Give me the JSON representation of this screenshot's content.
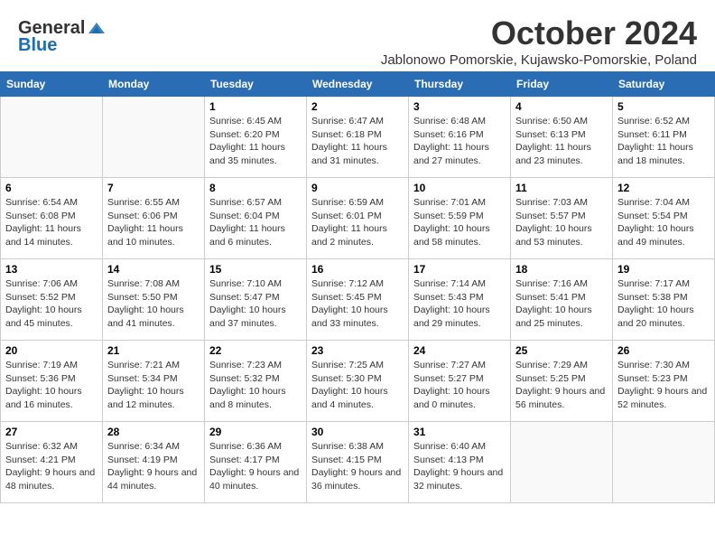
{
  "header": {
    "logo_general": "General",
    "logo_blue": "Blue",
    "title": "October 2024",
    "subtitle": "Jablonowo Pomorskie, Kujawsko-Pomorskie, Poland"
  },
  "weekdays": [
    "Sunday",
    "Monday",
    "Tuesday",
    "Wednesday",
    "Thursday",
    "Friday",
    "Saturday"
  ],
  "weeks": [
    [
      {
        "day": "",
        "info": ""
      },
      {
        "day": "",
        "info": ""
      },
      {
        "day": "1",
        "info": "Sunrise: 6:45 AM\nSunset: 6:20 PM\nDaylight: 11 hours and 35 minutes."
      },
      {
        "day": "2",
        "info": "Sunrise: 6:47 AM\nSunset: 6:18 PM\nDaylight: 11 hours and 31 minutes."
      },
      {
        "day": "3",
        "info": "Sunrise: 6:48 AM\nSunset: 6:16 PM\nDaylight: 11 hours and 27 minutes."
      },
      {
        "day": "4",
        "info": "Sunrise: 6:50 AM\nSunset: 6:13 PM\nDaylight: 11 hours and 23 minutes."
      },
      {
        "day": "5",
        "info": "Sunrise: 6:52 AM\nSunset: 6:11 PM\nDaylight: 11 hours and 18 minutes."
      }
    ],
    [
      {
        "day": "6",
        "info": "Sunrise: 6:54 AM\nSunset: 6:08 PM\nDaylight: 11 hours and 14 minutes."
      },
      {
        "day": "7",
        "info": "Sunrise: 6:55 AM\nSunset: 6:06 PM\nDaylight: 11 hours and 10 minutes."
      },
      {
        "day": "8",
        "info": "Sunrise: 6:57 AM\nSunset: 6:04 PM\nDaylight: 11 hours and 6 minutes."
      },
      {
        "day": "9",
        "info": "Sunrise: 6:59 AM\nSunset: 6:01 PM\nDaylight: 11 hours and 2 minutes."
      },
      {
        "day": "10",
        "info": "Sunrise: 7:01 AM\nSunset: 5:59 PM\nDaylight: 10 hours and 58 minutes."
      },
      {
        "day": "11",
        "info": "Sunrise: 7:03 AM\nSunset: 5:57 PM\nDaylight: 10 hours and 53 minutes."
      },
      {
        "day": "12",
        "info": "Sunrise: 7:04 AM\nSunset: 5:54 PM\nDaylight: 10 hours and 49 minutes."
      }
    ],
    [
      {
        "day": "13",
        "info": "Sunrise: 7:06 AM\nSunset: 5:52 PM\nDaylight: 10 hours and 45 minutes."
      },
      {
        "day": "14",
        "info": "Sunrise: 7:08 AM\nSunset: 5:50 PM\nDaylight: 10 hours and 41 minutes."
      },
      {
        "day": "15",
        "info": "Sunrise: 7:10 AM\nSunset: 5:47 PM\nDaylight: 10 hours and 37 minutes."
      },
      {
        "day": "16",
        "info": "Sunrise: 7:12 AM\nSunset: 5:45 PM\nDaylight: 10 hours and 33 minutes."
      },
      {
        "day": "17",
        "info": "Sunrise: 7:14 AM\nSunset: 5:43 PM\nDaylight: 10 hours and 29 minutes."
      },
      {
        "day": "18",
        "info": "Sunrise: 7:16 AM\nSunset: 5:41 PM\nDaylight: 10 hours and 25 minutes."
      },
      {
        "day": "19",
        "info": "Sunrise: 7:17 AM\nSunset: 5:38 PM\nDaylight: 10 hours and 20 minutes."
      }
    ],
    [
      {
        "day": "20",
        "info": "Sunrise: 7:19 AM\nSunset: 5:36 PM\nDaylight: 10 hours and 16 minutes."
      },
      {
        "day": "21",
        "info": "Sunrise: 7:21 AM\nSunset: 5:34 PM\nDaylight: 10 hours and 12 minutes."
      },
      {
        "day": "22",
        "info": "Sunrise: 7:23 AM\nSunset: 5:32 PM\nDaylight: 10 hours and 8 minutes."
      },
      {
        "day": "23",
        "info": "Sunrise: 7:25 AM\nSunset: 5:30 PM\nDaylight: 10 hours and 4 minutes."
      },
      {
        "day": "24",
        "info": "Sunrise: 7:27 AM\nSunset: 5:27 PM\nDaylight: 10 hours and 0 minutes."
      },
      {
        "day": "25",
        "info": "Sunrise: 7:29 AM\nSunset: 5:25 PM\nDaylight: 9 hours and 56 minutes."
      },
      {
        "day": "26",
        "info": "Sunrise: 7:30 AM\nSunset: 5:23 PM\nDaylight: 9 hours and 52 minutes."
      }
    ],
    [
      {
        "day": "27",
        "info": "Sunrise: 6:32 AM\nSunset: 4:21 PM\nDaylight: 9 hours and 48 minutes."
      },
      {
        "day": "28",
        "info": "Sunrise: 6:34 AM\nSunset: 4:19 PM\nDaylight: 9 hours and 44 minutes."
      },
      {
        "day": "29",
        "info": "Sunrise: 6:36 AM\nSunset: 4:17 PM\nDaylight: 9 hours and 40 minutes."
      },
      {
        "day": "30",
        "info": "Sunrise: 6:38 AM\nSunset: 4:15 PM\nDaylight: 9 hours and 36 minutes."
      },
      {
        "day": "31",
        "info": "Sunrise: 6:40 AM\nSunset: 4:13 PM\nDaylight: 9 hours and 32 minutes."
      },
      {
        "day": "",
        "info": ""
      },
      {
        "day": "",
        "info": ""
      }
    ]
  ]
}
